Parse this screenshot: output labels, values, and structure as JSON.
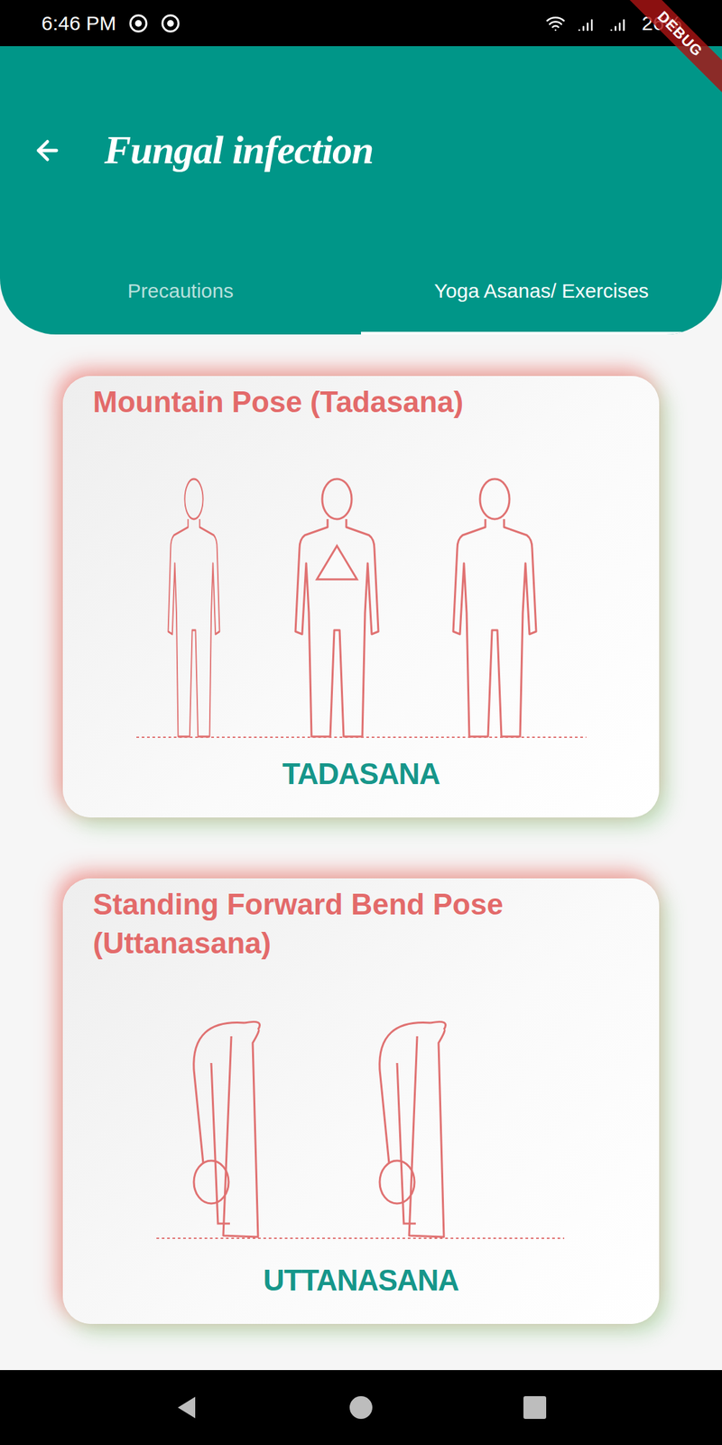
{
  "status_bar": {
    "time": "6:46 PM",
    "battery": "26%",
    "debug_banner": "DEBUG"
  },
  "app_bar": {
    "title": "Fungal infection"
  },
  "tabs": [
    {
      "label": "Precautions",
      "selected": false
    },
    {
      "label": "Yoga Asanas/ Exercises",
      "selected": true
    }
  ],
  "poses": [
    {
      "title": "Mountain Pose (Tadasana)",
      "name": "TADASANA",
      "kind": "standing"
    },
    {
      "title": "Standing Forward Bend Pose (Uttanasana)",
      "name": "UTTANASANA",
      "kind": "bending"
    }
  ]
}
